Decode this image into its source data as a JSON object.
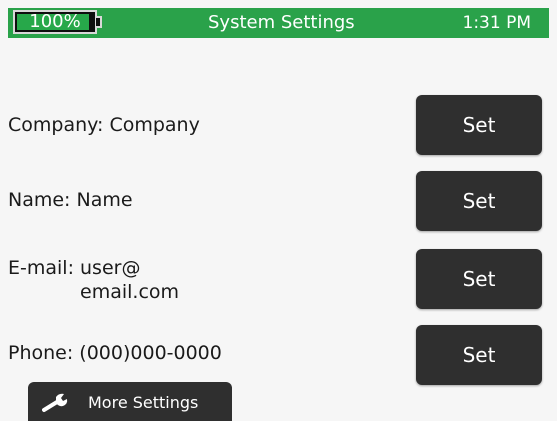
{
  "status_bar": {
    "battery_text": "100%",
    "battery_level": 1.0,
    "title": "System Settings",
    "time": "1:31 PM",
    "accent_color": "#2aa24a"
  },
  "settings": {
    "company": {
      "label": "Company: Company",
      "button": "Set"
    },
    "name": {
      "label": "Name: Name",
      "button": "Set"
    },
    "email": {
      "label_line1": "E-mail: user@",
      "label_line2": "email.com",
      "button": "Set"
    },
    "phone": {
      "label": "Phone: (000)000-0000",
      "button": "Set"
    }
  },
  "more_settings": {
    "label": "More Settings",
    "icon": "wrench-icon"
  }
}
